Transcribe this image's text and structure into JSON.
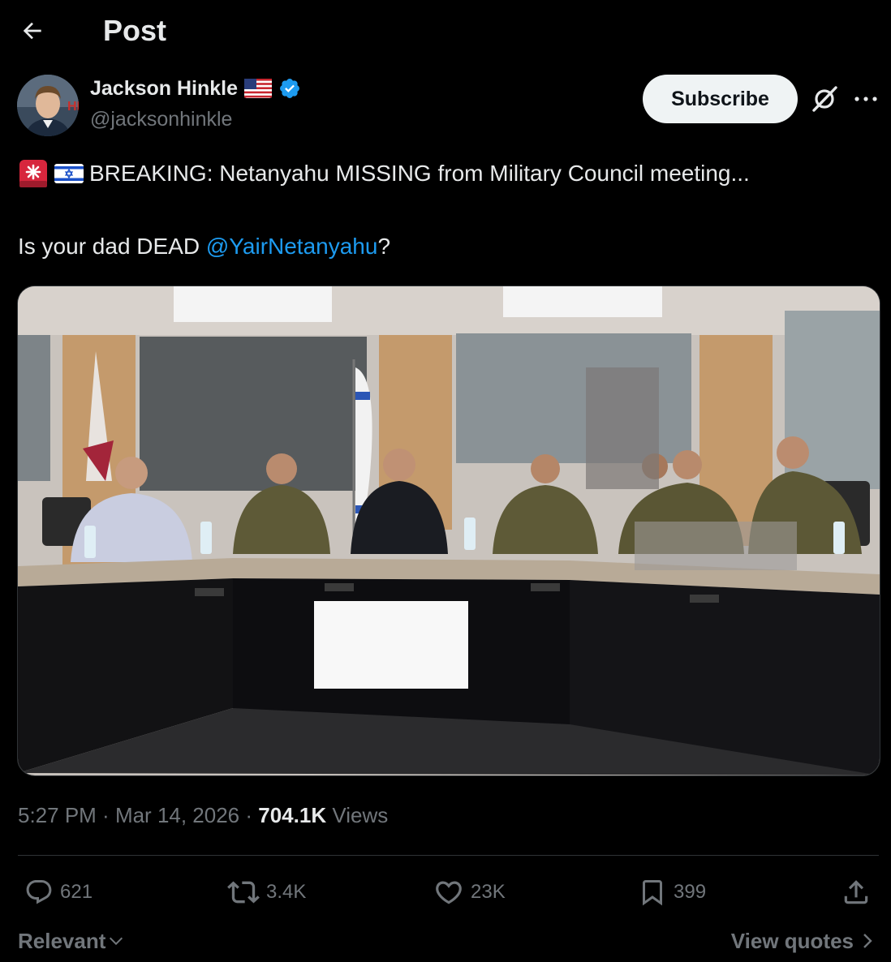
{
  "header": {
    "title": "Post",
    "back_icon": "arrow-left-icon"
  },
  "author": {
    "name": "Jackson Hinkle",
    "handle": "@jacksonhinkle",
    "flag_icon": "us-flag-icon",
    "verified_icon": "verified-badge-icon",
    "avatar_badge": "HB"
  },
  "actions_top": {
    "subscribe_label": "Subscribe",
    "grok_icon": "grok-icon",
    "more_icon": "more-icon"
  },
  "post": {
    "emojis": [
      "rotating-light-icon",
      "israel-flag-icon"
    ],
    "line1": "BREAKING: Netanyahu MISSING from Military Council meeting...",
    "line2_prefix": "Is your dad DEAD ",
    "mention": "@YairNetanyahu",
    "line2_suffix": "?"
  },
  "media": {
    "description_icon": "photo-icon"
  },
  "meta": {
    "time": "5:27 PM",
    "sep1": " · ",
    "date": "Mar 14, 2026",
    "sep2": " · ",
    "views": "704.1K",
    "views_label": " Views"
  },
  "stats": {
    "replies": "621",
    "reposts": "3.4K",
    "likes": "23K",
    "bookmarks": "399"
  },
  "footer": {
    "sort_label": "Relevant",
    "view_quotes": "View quotes"
  },
  "colors": {
    "accent": "#1d9bf0",
    "muted": "#71767b",
    "text": "#e7e9ea",
    "background": "#000000"
  }
}
